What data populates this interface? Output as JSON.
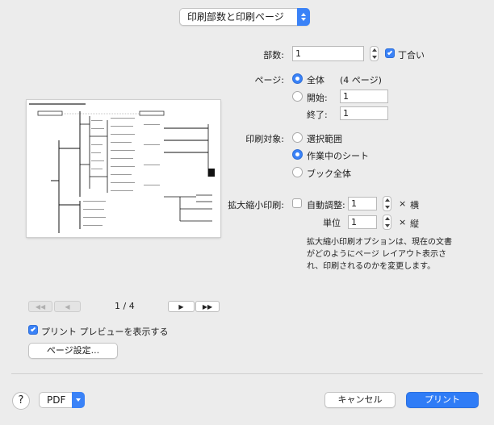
{
  "header": {
    "popup_label": "印刷部数と印刷ページ"
  },
  "copies": {
    "label": "部数:",
    "value": "1",
    "collate_label": "丁合い",
    "collate_checked": true
  },
  "pages": {
    "label": "ページ:",
    "all_label": "全体",
    "all_count": "(4 ページ)",
    "from_label": "開始:",
    "from_value": "1",
    "to_label": "終了:",
    "to_value": "1",
    "selected": "all"
  },
  "print_target": {
    "label": "印刷対象:",
    "options": [
      "選択範囲",
      "作業中のシート",
      "ブック全体"
    ],
    "selected_index": 1
  },
  "scaling": {
    "label": "拡大縮小印刷:",
    "auto_label": "自動調整:",
    "auto_checked": false,
    "horizontal_value": "1",
    "horizontal_label": "横",
    "unit_label": "単位",
    "vertical_value": "1",
    "vertical_label": "縦",
    "times": "×",
    "description": "拡大縮小印刷オプションは、現在の文書がどのようにページ レイアウト表示され、印刷されるのかを変更します。"
  },
  "preview_nav": {
    "first": "◀◀",
    "prev": "◀",
    "page_indicator": "1 / 4",
    "next": "▶",
    "last": "▶▶"
  },
  "show_preview": {
    "label": "プリント プレビューを表示する",
    "checked": true
  },
  "page_setup_label": "ページ設定...",
  "footer": {
    "help": "?",
    "pdf_label": "PDF",
    "cancel_label": "キャンセル",
    "print_label": "プリント"
  },
  "colors": {
    "accent": "#3a82f7",
    "background": "#ececec"
  }
}
